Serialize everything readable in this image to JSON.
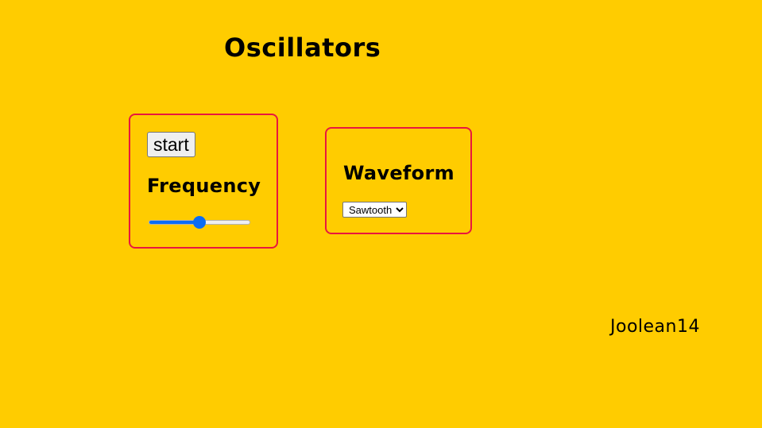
{
  "page": {
    "title": "Oscillators",
    "background_color": "#ffcc00",
    "accent_color": "#0a6cf5",
    "panel_border_color": "#e8173f"
  },
  "frequency_panel": {
    "start_label": "start",
    "heading": "Frequency",
    "slider_fraction": 0.5
  },
  "waveform_panel": {
    "heading": "Waveform",
    "selected": "Sawtooth"
  },
  "footer": {
    "credit": "Joolean14"
  }
}
